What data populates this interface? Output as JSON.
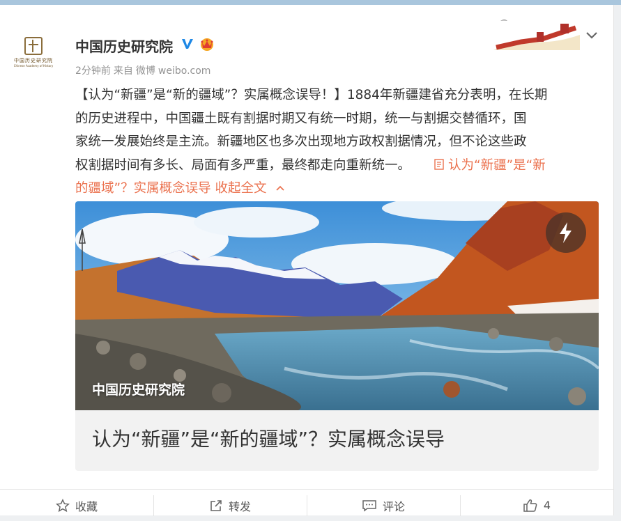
{
  "post": {
    "username": "中国历史研究院",
    "avatar_cn": "中国历史研究院",
    "avatar_en": "Chinese Academy of History",
    "time": "2分钟前",
    "source_prefix": "来自",
    "source_name": "微博",
    "source_domain": "weibo.com",
    "text_lines": [
      "【认为“新疆”是“新的疆域”？实属概念误导！】1884年新疆建省充分表明，在长期",
      "的历史进程中，中国疆土既有割据时期又有统一时期，统一与割据交替循环，国",
      "家统一发展始终是主流。新疆地区也多次出现地方政权割据情况，但不论这些政",
      "权割据时间有多长、局面有多严重，最终都走向重新统一。"
    ],
    "link_text_line1": "认为“新疆”是“新",
    "link_text_line2": "的疆域”？实属概念误导",
    "collapse_label": "收起全文",
    "media_watermark": "中国历史研究院",
    "media_caption": "认为“新疆”是“新的疆域”？实属概念误导"
  },
  "actions": {
    "favorite_label": "收藏",
    "repost_label": "转发",
    "comment_label": "评论",
    "like_count": "4"
  },
  "colors": {
    "link": "#eb7350",
    "verified": "#1e88e5",
    "meta": "#939393"
  },
  "icons": [
    "v-verified-icon",
    "crown-badge-icon",
    "great-wall-banner",
    "chevron-down-icon",
    "document-icon",
    "chevron-up-icon",
    "lightning-icon",
    "star-icon",
    "repost-icon",
    "comment-icon",
    "thumbs-up-icon"
  ]
}
